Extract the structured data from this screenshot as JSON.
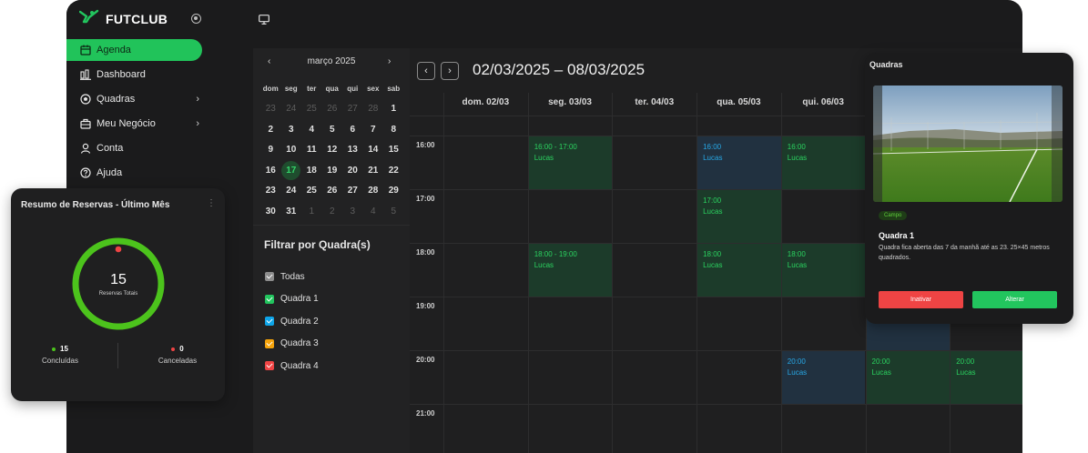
{
  "app": {
    "brand": "FUTCLUB",
    "sidebar": {
      "items": [
        {
          "label": "Agenda",
          "icon": "calendar-icon",
          "active": true
        },
        {
          "label": "Dashboard",
          "icon": "bar-chart-icon"
        },
        {
          "label": "Quadras",
          "icon": "soccer-ball-icon",
          "submenu": true
        },
        {
          "label": "Meu Negócio",
          "icon": "briefcase-icon",
          "submenu": true
        },
        {
          "label": "Conta",
          "icon": "user-icon"
        },
        {
          "label": "Ajuda",
          "icon": "help-circle-icon"
        }
      ]
    }
  },
  "mini_calendar": {
    "month_label": "março 2025",
    "prev": "‹",
    "next": "›",
    "weekdays": [
      "dom",
      "seg",
      "ter",
      "qua",
      "qui",
      "sex",
      "sab"
    ],
    "weeks": [
      [
        "23",
        "24",
        "25",
        "26",
        "27",
        "28",
        "1"
      ],
      [
        "2",
        "3",
        "4",
        "5",
        "6",
        "7",
        "8"
      ],
      [
        "9",
        "10",
        "11",
        "12",
        "13",
        "14",
        "15"
      ],
      [
        "16",
        "17",
        "18",
        "19",
        "20",
        "21",
        "22"
      ],
      [
        "23",
        "24",
        "25",
        "26",
        "27",
        "28",
        "29"
      ],
      [
        "30",
        "31",
        "1",
        "2",
        "3",
        "4",
        "5"
      ]
    ],
    "selected_day": "17"
  },
  "filter": {
    "title": "Filtrar por Quadra(s)",
    "options": [
      {
        "label": "Todas",
        "color": "#8c8c8c"
      },
      {
        "label": "Quadra 1",
        "color": "#22c55e"
      },
      {
        "label": "Quadra 2",
        "color": "#0ea5e9"
      },
      {
        "label": "Quadra 3",
        "color": "#f5a30b"
      },
      {
        "label": "Quadra 4",
        "color": "#ef4444"
      }
    ]
  },
  "week_view": {
    "prev": "‹",
    "next": "›",
    "title": "02/03/2025 – 08/03/2025",
    "days": [
      "dom. 02/03",
      "seg. 03/03",
      "ter. 04/03",
      "qua. 05/03",
      "qui. 06/03"
    ],
    "times": [
      "16:00",
      "17:00",
      "18:00",
      "19:00",
      "20:00",
      "21:00"
    ],
    "events": [
      {
        "day": 1,
        "slot": 0,
        "time": "16:00 - 17:00",
        "name": "Lucas",
        "color": "green"
      },
      {
        "day": 3,
        "slot": 0,
        "time": "16:00",
        "name": "Lucas",
        "color": "blue"
      },
      {
        "day": 4,
        "slot": 0,
        "time": "16:00",
        "name": "Lucas",
        "color": "green"
      },
      {
        "day": 3,
        "slot": 1,
        "time": "17:00",
        "name": "Lucas",
        "color": "green"
      },
      {
        "day": 1,
        "slot": 2,
        "time": "18:00 - 19:00",
        "name": "Lucas",
        "color": "green"
      },
      {
        "day": 3,
        "slot": 2,
        "time": "18:00",
        "name": "Lucas",
        "color": "green"
      },
      {
        "day": 4,
        "slot": 2,
        "time": "18:00",
        "name": "Lucas",
        "color": "green"
      },
      {
        "day": 4,
        "slot": 4,
        "time": "20:00",
        "name": "Lucas",
        "color": "blue"
      },
      {
        "day": 5,
        "slot": 4,
        "time": "20:00",
        "name": "Lucas",
        "color": "green"
      },
      {
        "day": 6,
        "slot": 4,
        "time": "20:00",
        "name": "Lucas",
        "color": "green"
      }
    ]
  },
  "court_card": {
    "title": "Quadras",
    "tag": "Campo",
    "name": "Quadra 1",
    "description": "Quadra fica aberta das 7 da manhã até as 23. 25×45 metros quadrados.",
    "deactivate_label": "Inativar",
    "edit_label": "Alterar",
    "colors": {
      "deactivate": "#ef4444",
      "edit": "#22c55e"
    }
  },
  "summary": {
    "title": "Resumo de Reservas - Último Mês",
    "menu": "⋮",
    "total": "15",
    "total_label": "Reservas Totais",
    "completed_count": "15",
    "completed_label": "Concluídas",
    "cancelled_count": "0",
    "cancelled_label": "Canceladas",
    "colors": {
      "completed": "#4cc31c",
      "cancelled": "#ef4444"
    }
  }
}
